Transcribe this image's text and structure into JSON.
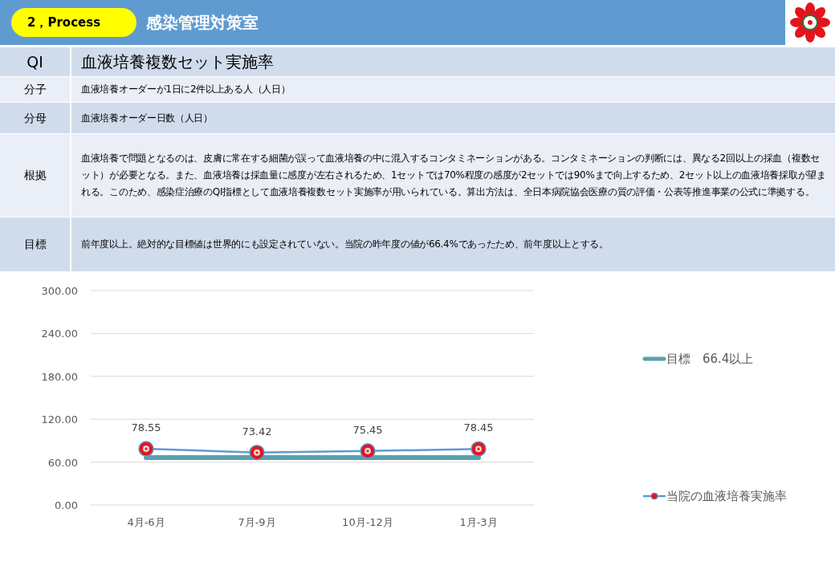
{
  "header": {
    "badge": "2，Process",
    "title": "感染管理対策室"
  },
  "table": {
    "title_row": {
      "label": "QI",
      "value": "血液培養複数セット実施率"
    },
    "rows": [
      {
        "label": "分子",
        "value": "血液培養オーダーが1日に2件以上ある人（人日）"
      },
      {
        "label": "分母",
        "value": "血液培養オーダー日数（人日）"
      },
      {
        "label": "根拠",
        "value": "血液培養で問題となるのは、皮膚に常在する細菌が誤って血液培養の中に混入するコンタミネーションがある。コンタミネーションの判断には、異なる2回以上の採血（複数セット）が必要となる。また、血液培養は採血量に感度が左右されるため、1セットでは70%程度の感度が2セットでは90%まで向上するため、2セット以上の血液培養採取が望まれる。このため、感染症治療のQI指標として血液培養複数セット実施率が用いられている。算出方法は、全日本病院協会医療の質の評価・公表等推進事業の公式に準拠する。"
      },
      {
        "label": "目標",
        "value": "前年度以上。絶対的な目標値は世界的にも設定されていない。当院の昨年度の値が66.4%であったため、前年度以上とする。"
      }
    ]
  },
  "chart_data": {
    "type": "line",
    "categories": [
      "4月-6月",
      "7月-9月",
      "10月-12月",
      "1月-3月"
    ],
    "series": [
      {
        "name": "目標　66.4以上",
        "color": "#5aa0ad",
        "values": [
          66.4,
          66.4,
          66.4,
          66.4
        ]
      },
      {
        "name": "当院の血液培養実施率",
        "color": "#5b9bd5",
        "marker": "circle",
        "values": [
          78.55,
          73.42,
          75.45,
          78.45
        ]
      }
    ],
    "ylim": [
      0,
      300
    ],
    "grid": true,
    "yticks": [
      {
        "value": 0,
        "label": "0.00"
      },
      {
        "value": 60,
        "label": "60.00"
      },
      {
        "value": 120,
        "label": "120.00"
      },
      {
        "value": 180,
        "label": "180.00"
      },
      {
        "value": 240,
        "label": "240.00"
      },
      {
        "value": 300,
        "label": "300.00"
      }
    ],
    "value_labels": [
      "78.55",
      "73.42",
      "75.45",
      "78.45"
    ]
  }
}
